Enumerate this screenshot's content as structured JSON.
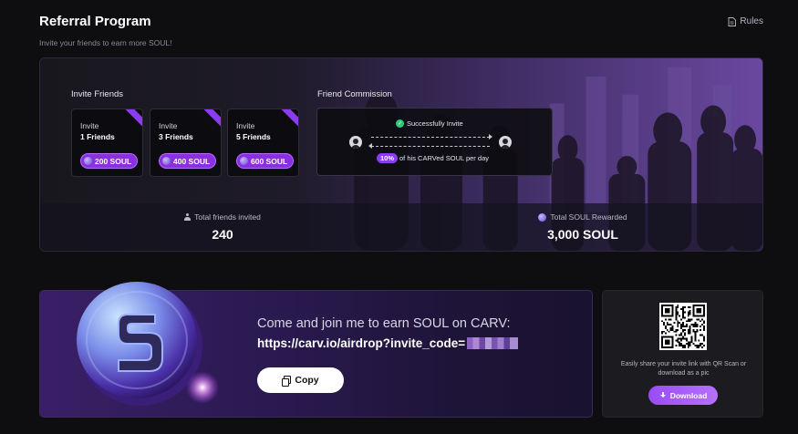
{
  "header": {
    "title": "Referral Program",
    "subtitle": "Invite your friends to earn more SOUL!",
    "rules_label": "Rules"
  },
  "invite_friends": {
    "label": "Invite Friends",
    "cards": [
      {
        "line1": "Invite",
        "line2": "1 Friends",
        "reward": "200 SOUL"
      },
      {
        "line1": "Invite",
        "line2": "3 Friends",
        "reward": "400 SOUL"
      },
      {
        "line1": "Invite",
        "line2": "5 Friends",
        "reward": "600 SOUL"
      }
    ]
  },
  "commission": {
    "label": "Friend Commission",
    "success_text": "Successfully Invite",
    "percent": "10%",
    "percent_suffix": "of his CARVed SOUL per day"
  },
  "stats": {
    "friends_label": "Total friends invited",
    "friends_value": "240",
    "soul_label": "Total SOUL Rewarded",
    "soul_value": "3,000 SOUL"
  },
  "share": {
    "line1": "Come and join me to earn SOUL on CARV:",
    "link": "https://carv.io/airdrop?invite_code=",
    "copy_label": "Copy"
  },
  "qr": {
    "hint": "Easily share your invite link with QR Scan or download as a pic",
    "download_label": "Download"
  },
  "colors": {
    "accent": "#8b3cf0",
    "success": "#2ecb7a",
    "background": "#0e0e10"
  }
}
